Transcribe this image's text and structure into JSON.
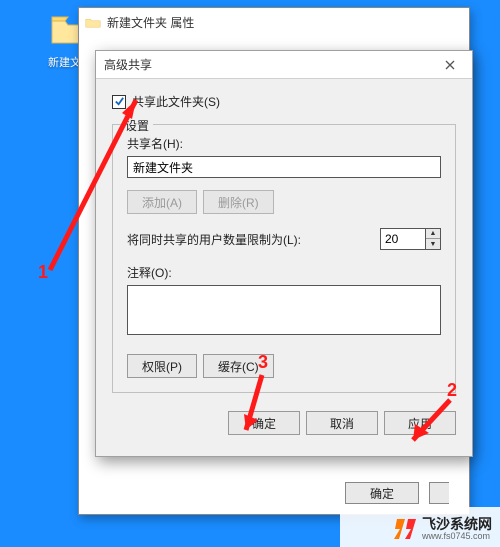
{
  "desktop": {
    "icon_label": "新建文…"
  },
  "properties_window": {
    "title": "新建文件夹 属性",
    "ok": "确定"
  },
  "advanced_dialog": {
    "title": "高级共享",
    "share_checkbox": "共享此文件夹(S)",
    "group_label": "设置",
    "share_name_label": "共享名(H):",
    "share_name_value": "新建文件夹",
    "add_button": "添加(A)",
    "remove_button": "删除(R)",
    "limit_label": "将同时共享的用户数量限制为(L):",
    "limit_value": "20",
    "notes_label": "注释(O):",
    "permissions_button": "权限(P)",
    "cache_button": "缓存(C)",
    "ok": "确定",
    "cancel": "取消",
    "apply": "应用"
  },
  "annotations": {
    "one": "1",
    "two": "2",
    "three": "3"
  },
  "watermark": {
    "name": "飞沙系统网",
    "url": "www.fs0745.com"
  }
}
